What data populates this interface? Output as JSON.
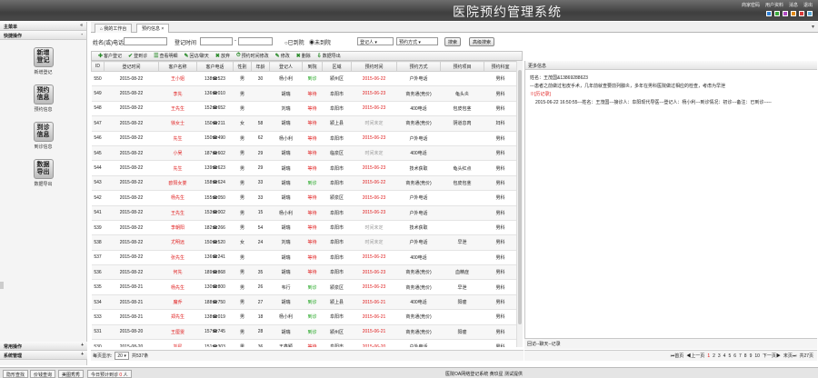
{
  "app": {
    "title": "医院预约管理系统",
    "links": [
      "商家密码",
      "用户资料",
      "消息",
      "退出"
    ],
    "swatches": [
      "#2e7fd6",
      "#39a839",
      "#b048c2",
      "#e08a16",
      "#d83a3a",
      "#5aaad8"
    ]
  },
  "sidebar": {
    "header": "主菜单",
    "section": "快捷操作",
    "items": [
      {
        "big": "新增登记",
        "label": "新增登记"
      },
      {
        "big": "预约信息",
        "label": "预约信息"
      },
      {
        "big": "到诊信息",
        "label": "到诊信息"
      },
      {
        "big": "数据导出",
        "label": "数据导出"
      }
    ],
    "foot": [
      "常用操作",
      "系统管理"
    ]
  },
  "tabs": [
    "我的工作台",
    "预约信息"
  ],
  "search": {
    "name_phone": "姓名(或)电话",
    "reg_time": "登记时间",
    "sep": "-",
    "radio1": "已到院",
    "radio2": "未到院",
    "registrar": "登记人",
    "method": "预约方式",
    "search_btn": "搜索",
    "adv_btn": "高级搜索"
  },
  "toolbar": [
    "客户登记",
    "登到诊",
    "查看明细",
    "回访/聊天",
    "放弃",
    "预约时间修改",
    "修改",
    "删除",
    "数据导出"
  ],
  "columns": [
    "ID",
    "登记时间",
    "客户名称",
    "客户电话",
    "性别",
    "年龄",
    "登记人",
    "到院",
    "区域",
    "预约时间",
    "预约方式",
    "预约项目",
    "预约科室"
  ],
  "rows": [
    [
      "550",
      "2015-08-22",
      "王小姐",
      "138☎523",
      "男",
      "30",
      "杨小利",
      "到诊",
      "颍州区",
      "2015-06-22",
      "户外电话",
      "",
      "男科"
    ],
    [
      "549",
      "2015-08-22",
      "李先",
      "136☎010",
      "男",
      "",
      "胡瑞",
      "等待",
      "阜阳市",
      "2015-06-23",
      "商务通(竞价)",
      "龟头炎",
      "男科"
    ],
    [
      "548",
      "2015-08-22",
      "王先生",
      "152☎652",
      "男",
      "",
      "刘瑞",
      "等待",
      "阜阳市",
      "2015-06-23",
      "400电话",
      "包皮包茎",
      "男科"
    ],
    [
      "547",
      "2015-08-22",
      "徐女士",
      "150☎211",
      "女",
      "58",
      "胡瑞",
      "等待",
      "颍上县",
      "时间未定",
      "商务通(竞价)",
      "阴道息肉",
      "妇科"
    ],
    [
      "546",
      "2015-08-22",
      "先生",
      "150☎490",
      "男",
      "62",
      "杨小利",
      "等待",
      "阜阳市",
      "2015-06-23",
      "户外电话",
      "",
      "男科"
    ],
    [
      "545",
      "2015-08-22",
      "小吴",
      "187☎602",
      "男",
      "29",
      "胡瑞",
      "等待",
      "临泉区",
      "时间未定",
      "400电话",
      "",
      "男科"
    ],
    [
      "544",
      "2015-08-22",
      "先生",
      "139☎623",
      "男",
      "29",
      "胡瑞",
      "等待",
      "阜阳市",
      "2015-06-23",
      "技术获取",
      "龟头红点",
      "男科"
    ],
    [
      "543",
      "2015-08-22",
      "欧阳女娄",
      "158☎624",
      "男",
      "33",
      "胡瑞",
      "到诊",
      "阜阳市",
      "2015-06-22",
      "商务通(竞价)",
      "包皮包茎",
      "男科"
    ],
    [
      "542",
      "2015-08-22",
      "杨先生",
      "155☎050",
      "男",
      "33",
      "胡瑞",
      "等待",
      "颍泉区",
      "2015-06-23",
      "户外电话",
      "",
      "男科"
    ],
    [
      "541",
      "2015-08-22",
      "王先生",
      "153☎002",
      "男",
      "15",
      "杨小利",
      "等待",
      "阜阳市",
      "2015-06-23",
      "户外电话",
      "",
      "男科"
    ],
    [
      "539",
      "2015-08-22",
      "李朝阳",
      "182☎266",
      "男",
      "54",
      "胡瑞",
      "等待",
      "阜阳市",
      "时间未定",
      "技术获取",
      "",
      "男科"
    ],
    [
      "538",
      "2015-08-22",
      "尤明远",
      "150☎520",
      "女",
      "24",
      "刘瑞",
      "等待",
      "阜阳市",
      "时间未定",
      "户外电话",
      "早泄",
      "男科"
    ],
    [
      "537",
      "2015-08-22",
      "张先生",
      "136☎241",
      "男",
      "",
      "胡瑞",
      "等待",
      "阜阳市",
      "2015-06-23",
      "400电话",
      "",
      "男科"
    ],
    [
      "536",
      "2015-08-22",
      "何先",
      "189☎868",
      "男",
      "35",
      "胡瑞",
      "等待",
      "阜阳市",
      "2015-06-23",
      "商务通(竞价)",
      "血精症",
      "男科"
    ],
    [
      "535",
      "2015-08-21",
      "杨先生",
      "130☎800",
      "男",
      "26",
      "韦行",
      "到诊",
      "颍泉区",
      "2015-06-23",
      "商务通(竞价)",
      "早泄",
      "男科"
    ],
    [
      "534",
      "2015-08-21",
      "魔乔",
      "188☎750",
      "男",
      "27",
      "胡瑞",
      "到诊",
      "颍上县",
      "2015-06-21",
      "400电话",
      "阳痿",
      "男科"
    ],
    [
      "533",
      "2015-08-21",
      "郑先生",
      "138☎019",
      "男",
      "18",
      "杨小利",
      "到诊",
      "阜阳市",
      "2015-06-21",
      "商务通(竞价)",
      "",
      "男科"
    ],
    [
      "531",
      "2015-08-20",
      "王厘雯",
      "157☎745",
      "男",
      "28",
      "胡瑞",
      "到诊",
      "颍州区",
      "2015-06-21",
      "商务通(竞价)",
      "阳痿",
      "男科"
    ],
    [
      "530",
      "2015-08-20",
      "刘星",
      "151☎303",
      "男",
      "36",
      "王鑫颖",
      "等待",
      "阜阳市",
      "2015-06-20",
      "户外电话",
      "",
      "男科"
    ]
  ],
  "right": {
    "header": "更多信息",
    "name_line": "姓名：王茂国&13869288623",
    "desc": "---患者之前做过包皮手术，几年前就查要前列腺炎，多年在男科医院做过相应的检查，考虑为早泄",
    "history_label": "※[历记录]",
    "history": "2015-06-22 16:50:55---姓名：王茂国---接诊人：阜阳现代导医---登记人：杨小利---到诊情况：初诊---备注：已到诊-----",
    "footer": "回访--聊天--记录"
  },
  "pager_left": {
    "label": "每页显示:",
    "per_page": "20",
    "suffix": "共537条"
  },
  "pager_right": {
    "first": "首页",
    "prev": "上一页",
    "pages": [
      "1",
      "2",
      "3",
      "4",
      "5",
      "6",
      "7",
      "8",
      "9",
      "10"
    ],
    "current": "1",
    "next": "下一页",
    "last": "末页",
    "total": "共27页"
  },
  "statusbar": {
    "tabs": [
      "隐形查找",
      "价钱查询",
      "美图秀秀"
    ],
    "today_label": "今日预计到诊",
    "today_count": "0",
    "today_unit": "人",
    "copyright": "医院OA网络登记系统 黄玖星 测试提供"
  }
}
